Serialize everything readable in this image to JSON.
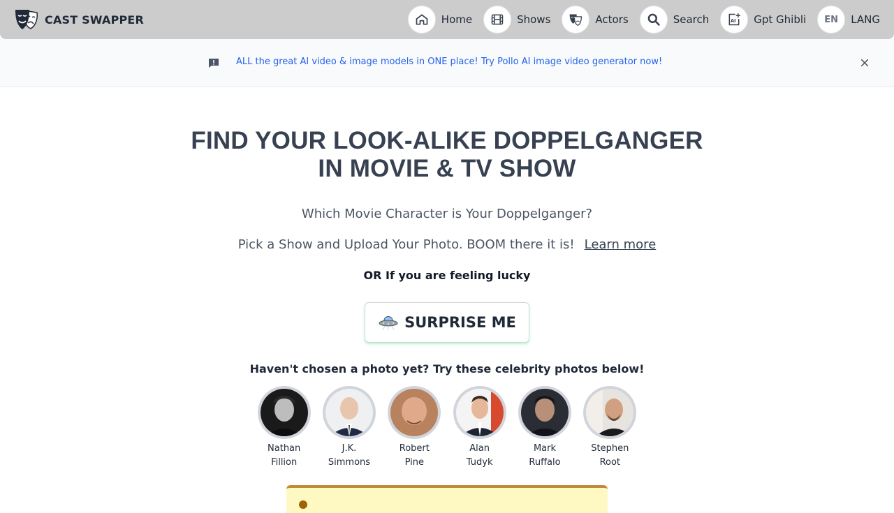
{
  "brand": {
    "name": "CAST SWAPPER",
    "logo_icon": "theater-masks-icon"
  },
  "nav": {
    "items": [
      {
        "label": "Home",
        "icon": "home-icon"
      },
      {
        "label": "Shows",
        "icon": "film-icon"
      },
      {
        "label": "Actors",
        "icon": "masks-icon"
      },
      {
        "label": "Search",
        "icon": "search-icon"
      },
      {
        "label": "Gpt Ghibli",
        "icon": "ai-image-icon"
      },
      {
        "label": "LANG",
        "code": "EN"
      }
    ]
  },
  "banner": {
    "text": "ALL the great AI video & image models in ONE place! Try Pollo AI image video generator now!",
    "link_color": "#2563eb"
  },
  "hero": {
    "title_line1": "FIND YOUR LOOK-ALIKE DOPPELGANGER",
    "title_line2": "IN MOVIE & TV SHOW",
    "subtitle": "Which Movie Character is Your Doppelganger?",
    "pick_text": "Pick a Show and Upload Your Photo. BOOM there it is!",
    "learn_more": "Learn more",
    "lucky": "OR If you are feeling lucky",
    "surprise_label": "SURPRISE ME"
  },
  "celebs": {
    "prompt": "Haven't chosen a photo yet? Try these celebrity photos below!",
    "items": [
      {
        "first": "Nathan",
        "last": "Fillion"
      },
      {
        "first": "J.K.",
        "last": "Simmons"
      },
      {
        "first": "Robert",
        "last": "Pine"
      },
      {
        "first": "Alan",
        "last": "Tudyk"
      },
      {
        "first": "Mark",
        "last": "Ruffalo"
      },
      {
        "first": "Stephen",
        "last": "Root"
      }
    ]
  },
  "colors": {
    "navbar": "#cccccc",
    "heading": "#374151",
    "card_border": "#c28b3a",
    "card_bg": "#fef9c3"
  }
}
